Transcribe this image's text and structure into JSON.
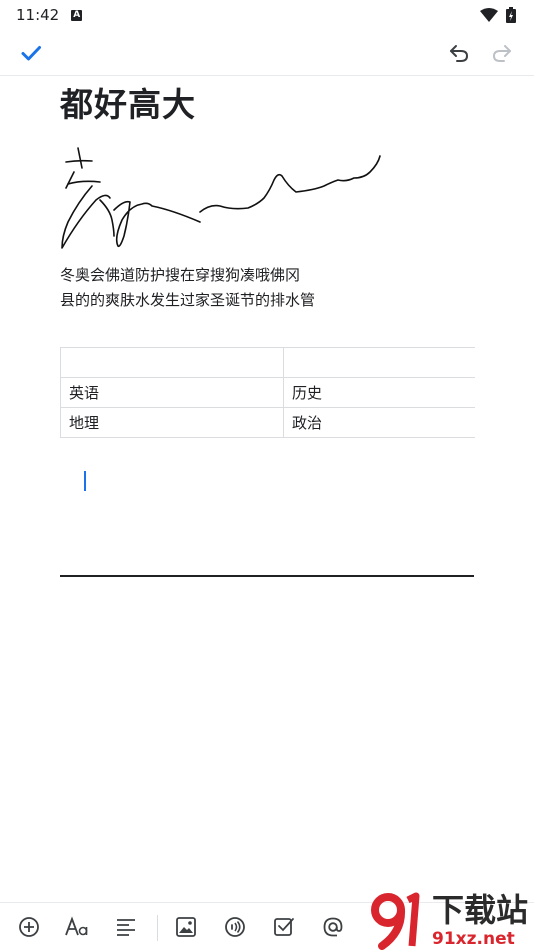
{
  "status": {
    "time": "11:42",
    "badge": "A"
  },
  "note": {
    "title": "都好高大",
    "paragraph_line1": "冬奥会佛道防护搜在穿搜狗凑哦佛冈",
    "paragraph_line2": "县的的爽肤水发生过家圣诞节的排水管",
    "table": [
      [
        "",
        ""
      ],
      [
        "英语",
        "历史"
      ],
      [
        "地理",
        "政治"
      ]
    ]
  },
  "watermark": {
    "line1": "下载站",
    "line2": "91xz.net"
  },
  "colors": {
    "accent": "#1a73e8",
    "icon": "#3c4043",
    "watermark_red": "#d9262e"
  },
  "icons": {
    "done": "check-icon",
    "undo": "undo-icon",
    "redo": "redo-icon",
    "add": "add-circle-icon",
    "text_format": "text-format-icon",
    "align": "align-left-icon",
    "image": "image-icon",
    "audio": "audio-icon",
    "checkbox": "checkbox-icon",
    "mention": "at-icon"
  }
}
